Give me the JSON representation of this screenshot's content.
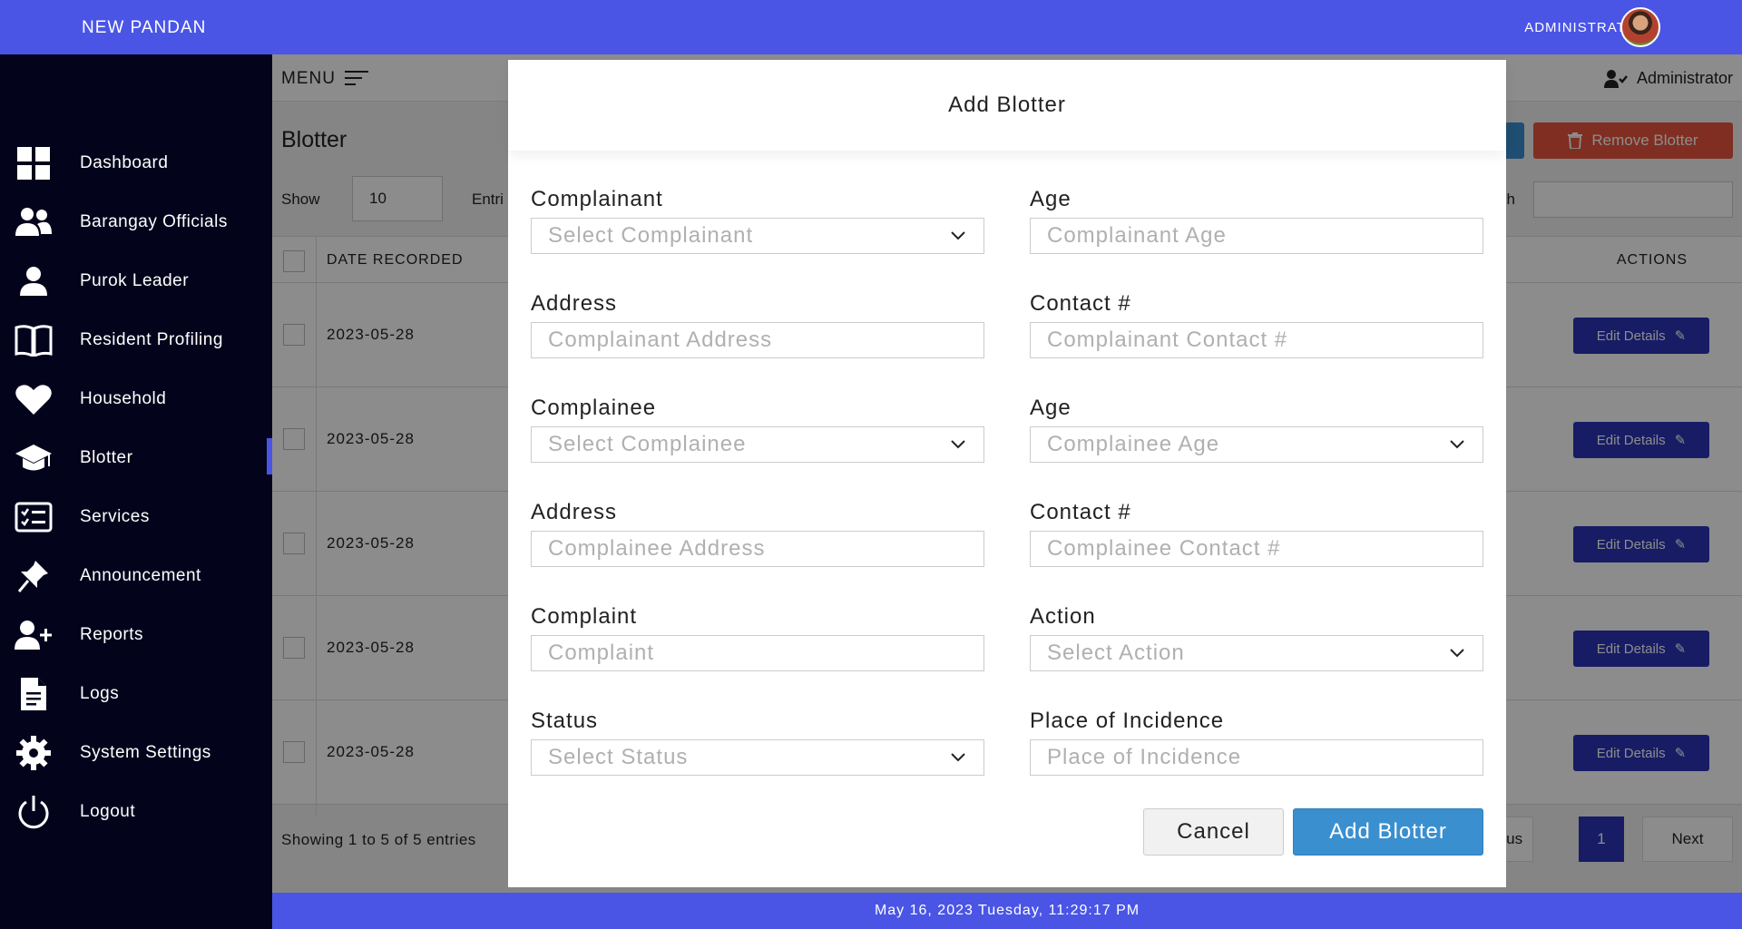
{
  "topbar": {
    "brand": "NEW PANDAN",
    "user_role": "ADMINISTRATOR"
  },
  "sidebar": {
    "items": [
      {
        "label": "Dashboard",
        "icon": "dashboard-grid-icon"
      },
      {
        "label": "Barangay Officials",
        "icon": "users-icon"
      },
      {
        "label": "Purok Leader",
        "icon": "user-icon"
      },
      {
        "label": "Resident Profiling",
        "icon": "book-icon"
      },
      {
        "label": "Household",
        "icon": "heart-icon"
      },
      {
        "label": "Blotter",
        "icon": "graduation-cap-icon",
        "active": true
      },
      {
        "label": "Services",
        "icon": "checklist-icon"
      },
      {
        "label": "Announcement",
        "icon": "pin-icon"
      },
      {
        "label": "Reports",
        "icon": "user-plus-icon"
      },
      {
        "label": "Logs",
        "icon": "document-icon"
      },
      {
        "label": "System Settings",
        "icon": "gear-icon"
      },
      {
        "label": "Logout",
        "icon": "power-icon"
      }
    ]
  },
  "main": {
    "menu_label": "MENU",
    "user_name": "Administrator",
    "page_title": "Blotter",
    "remove_button": "Remove Blotter",
    "show_label": "Show",
    "show_value": "10",
    "entries_label": "Entri",
    "search_label": "h",
    "columns": {
      "date": "DATE RECORDED",
      "actions": "ACTIONS"
    },
    "rows": [
      {
        "date": "2023-05-28",
        "action": "Edit Details"
      },
      {
        "date": "2023-05-28",
        "action": "Edit Details"
      },
      {
        "date": "2023-05-28",
        "action": "Edit Details"
      },
      {
        "date": "2023-05-28",
        "action": "Edit Details"
      },
      {
        "date": "2023-05-28",
        "action": "Edit Details"
      }
    ],
    "showing": "Showing 1 to 5 of 5 entries",
    "pagination": {
      "previous": "Previous",
      "current": "1",
      "next": "Next"
    }
  },
  "footer": {
    "datetime": "May 16, 2023 Tuesday, 11:29:17 PM"
  },
  "modal": {
    "title": "Add Blotter",
    "fields": {
      "complainant": {
        "label": "Complainant",
        "placeholder": "Select Complainant"
      },
      "complainant_age": {
        "label": "Age",
        "placeholder": "Complainant Age"
      },
      "complainant_address": {
        "label": "Address",
        "placeholder": "Complainant Address"
      },
      "complainant_contact": {
        "label": "Contact #",
        "placeholder": "Complainant Contact #"
      },
      "complainee": {
        "label": "Complainee",
        "placeholder": "Select Complainee"
      },
      "complainee_age": {
        "label": "Age",
        "placeholder": "Complainee Age"
      },
      "complainee_address": {
        "label": "Address",
        "placeholder": "Complainee Address"
      },
      "complainee_contact": {
        "label": "Contact #",
        "placeholder": "Complainee Contact #"
      },
      "complaint": {
        "label": "Complaint",
        "placeholder": "Complaint"
      },
      "action": {
        "label": "Action",
        "placeholder": "Select Action"
      },
      "status": {
        "label": "Status",
        "placeholder": "Select Status"
      },
      "place": {
        "label": "Place of Incidence",
        "placeholder": "Place of Incidence"
      }
    },
    "cancel_button": "Cancel",
    "submit_button": "Add Blotter"
  },
  "colors": {
    "brand": "#4a55e6",
    "sidebar": "#03031c",
    "primary_button": "#3a8fcf",
    "danger": "#e8553d",
    "edit_button": "#2b33b8"
  }
}
